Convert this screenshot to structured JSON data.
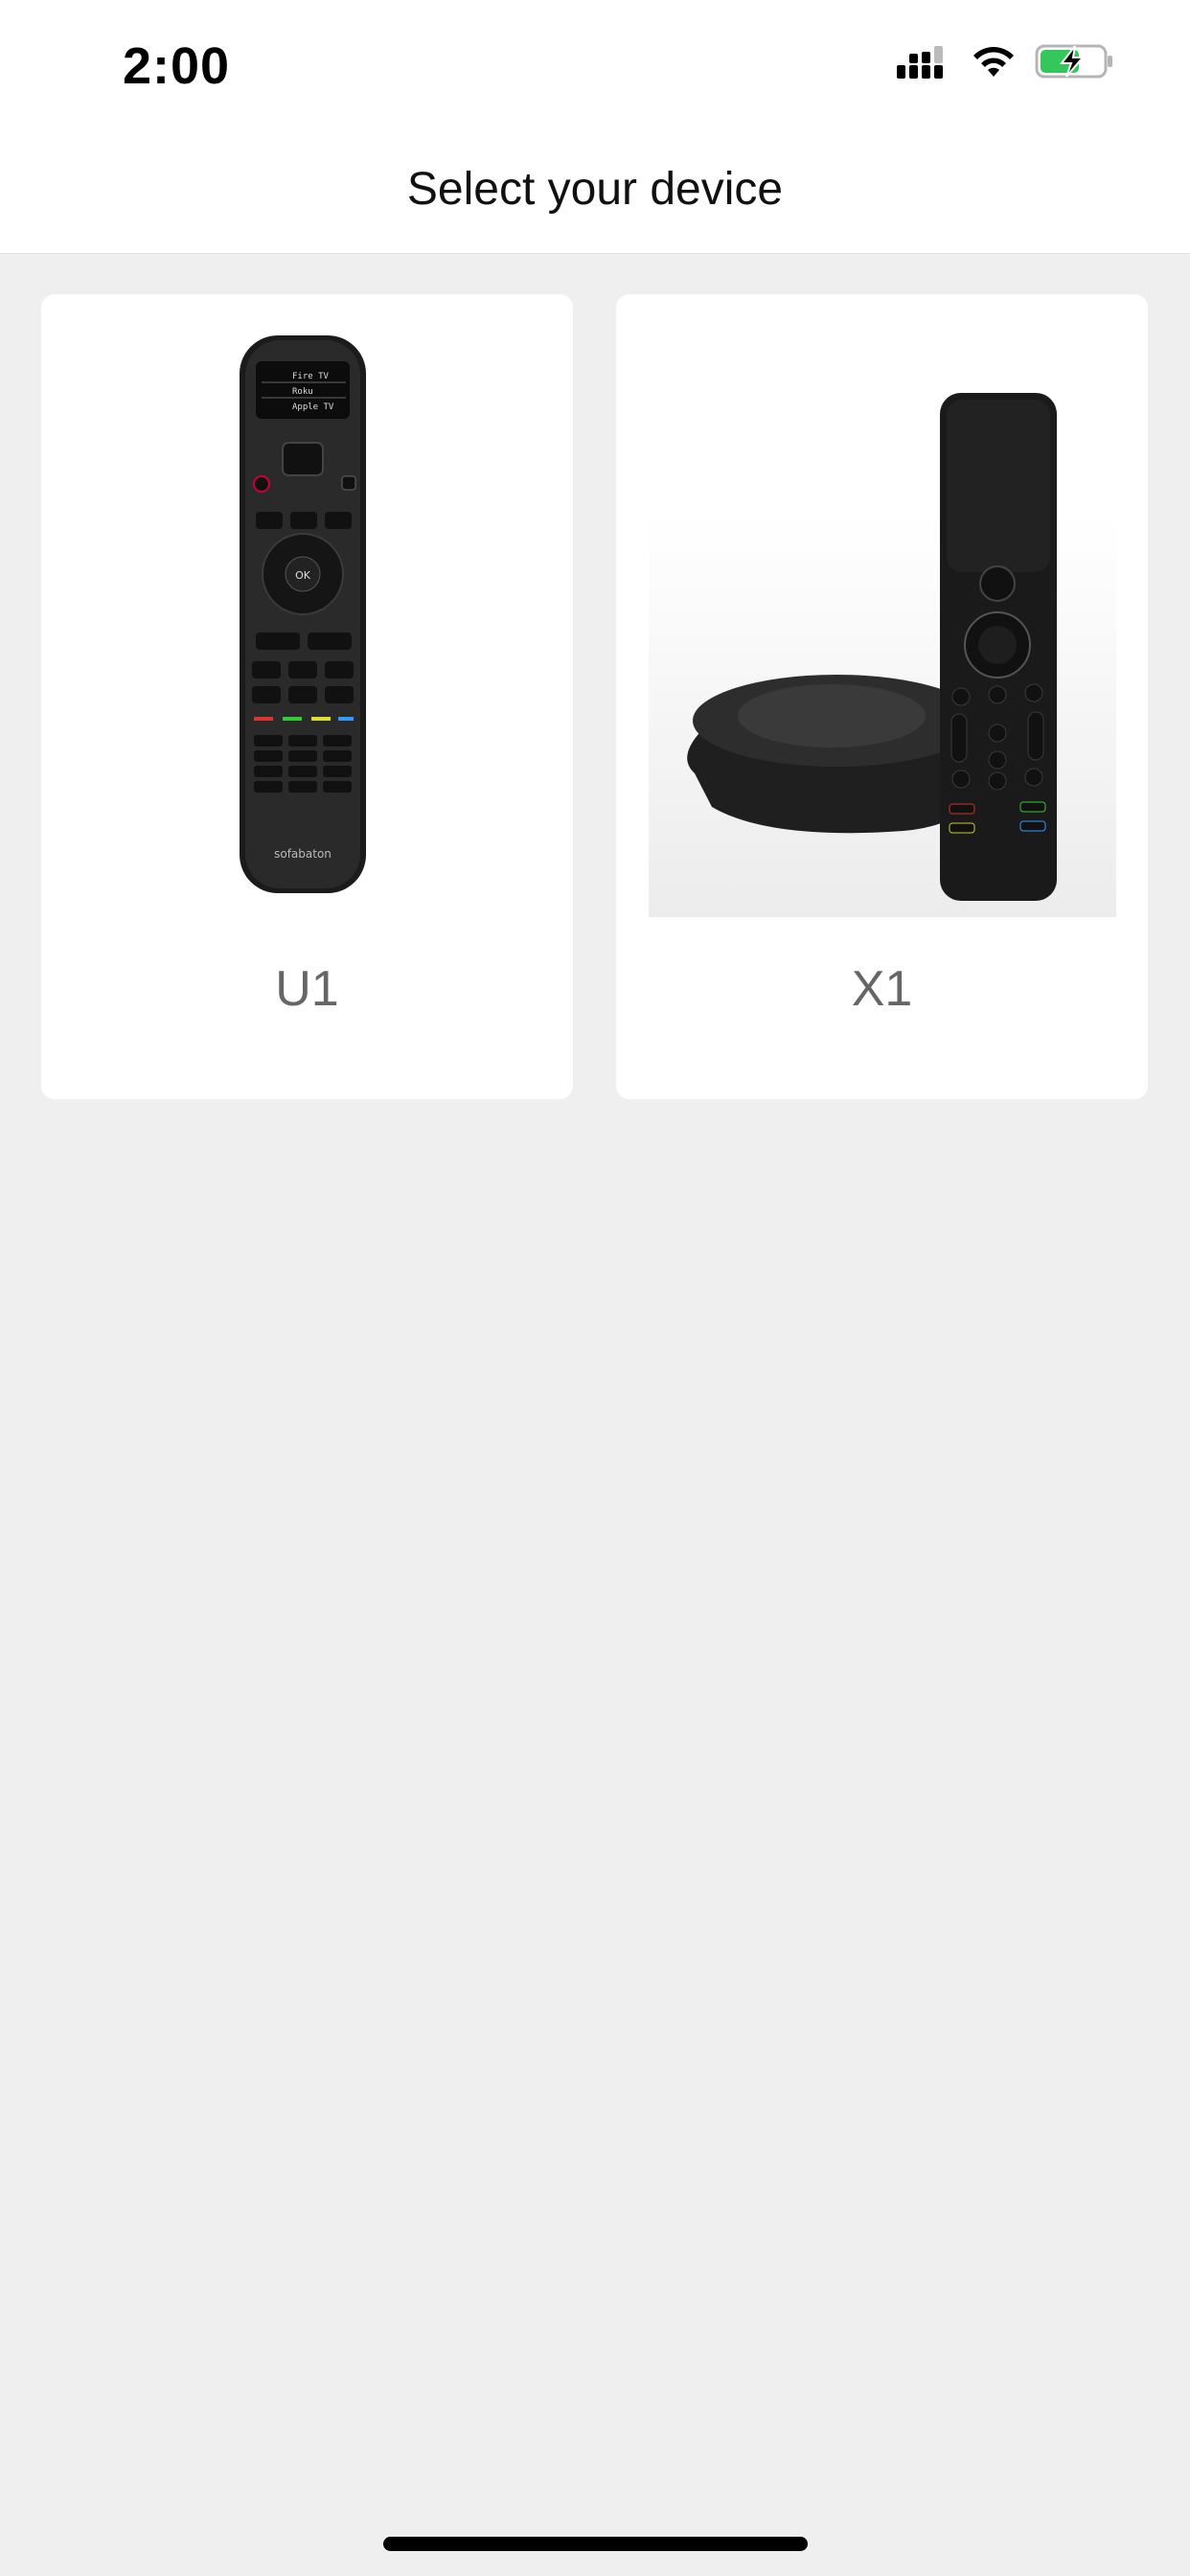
{
  "status_bar": {
    "time": "2:00",
    "icons": [
      "cellular-signal-icon",
      "wifi-icon",
      "battery-charging-icon"
    ]
  },
  "header": {
    "title": "Select your device"
  },
  "devices": [
    {
      "label": "U1",
      "screen_lines": [
        "Fire TV",
        "Roku",
        "Apple TV"
      ],
      "ok_label": "OK",
      "brand": "sofabaton"
    },
    {
      "label": "X1"
    }
  ],
  "colors": {
    "background": "#efefef",
    "card": "#ffffff",
    "label": "#666666",
    "battery_fill": "#34c759"
  }
}
